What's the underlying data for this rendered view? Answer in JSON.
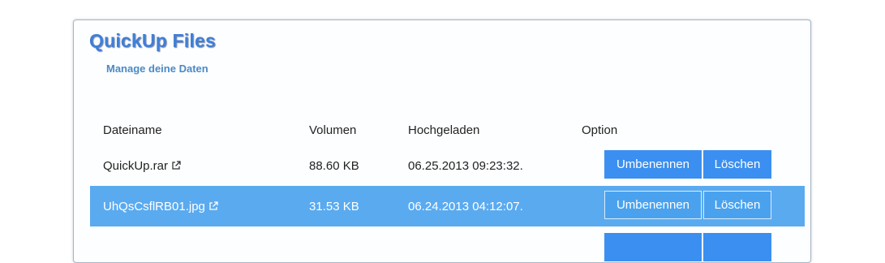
{
  "app": {
    "title": "QuickUp Files",
    "subtitle": "Manage deine Daten"
  },
  "table": {
    "headers": {
      "name": "Dateiname",
      "size": "Volumen",
      "uploaded": "Hochgeladen",
      "option": "Option"
    },
    "rows": [
      {
        "name": "QuickUp.rar",
        "size": "88.60 KB",
        "uploaded": "06.25.2013 09:23:32.",
        "selected": false
      },
      {
        "name": "UhQsCsflRB01.jpg",
        "size": "31.53 KB",
        "uploaded": "06.24.2013 04:12:07.",
        "selected": true
      }
    ],
    "actions": {
      "rename": "Umbenennen",
      "delete": "Löschen"
    }
  },
  "colors": {
    "accent": "#3b8ff0",
    "selected_row": "#5aaaf0",
    "title": "#3f7fd8"
  },
  "icons": {
    "external_link": "external-link-icon"
  }
}
